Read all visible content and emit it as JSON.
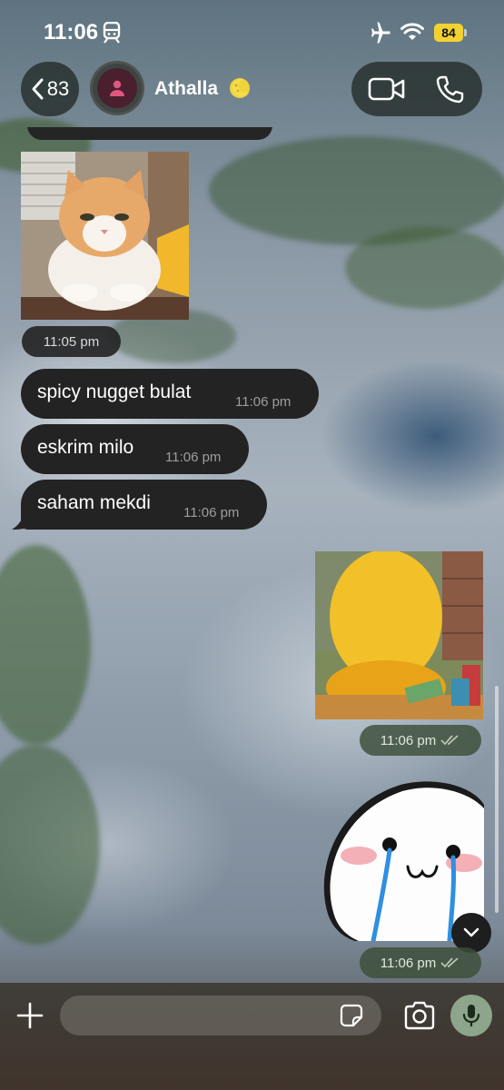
{
  "status_bar": {
    "time": "11:06",
    "battery_level": "84"
  },
  "header": {
    "back_count": "83",
    "contact_name": "Athalla",
    "icons": [
      "train-icon",
      "airplane-icon",
      "wifi-icon",
      "chevron-left-icon",
      "person-icon",
      "moon-icon",
      "video-call-icon",
      "phone-icon"
    ]
  },
  "messages": [
    {
      "type": "photo",
      "direction": "incoming",
      "description_icon": "cat-photo",
      "time": "11:05 pm"
    },
    {
      "type": "text",
      "direction": "incoming",
      "text": "spicy nugget bulat",
      "time": "11:06 pm"
    },
    {
      "type": "text",
      "direction": "incoming",
      "text": "eskrim milo",
      "time": "11:06 pm"
    },
    {
      "type": "text",
      "direction": "incoming",
      "text": "saham mekdi",
      "time": "11:06 pm"
    },
    {
      "type": "photo",
      "direction": "outgoing",
      "description_icon": "yellow-character-photo",
      "time": "11:06 pm",
      "status": "read"
    },
    {
      "type": "sticker",
      "direction": "outgoing",
      "description_icon": "crying-blob-sticker",
      "time": "11:06 pm",
      "status": "read"
    }
  ],
  "composer": {
    "placeholder": "",
    "value": ""
  },
  "colors": {
    "battery": "#f2d233",
    "incoming_bubble": "#232323",
    "outgoing_time_pill": "#3c4e38",
    "mic_button": "#8da58a",
    "avatar_bg": "#4a1f2e",
    "avatar_person": "#e0567f"
  }
}
